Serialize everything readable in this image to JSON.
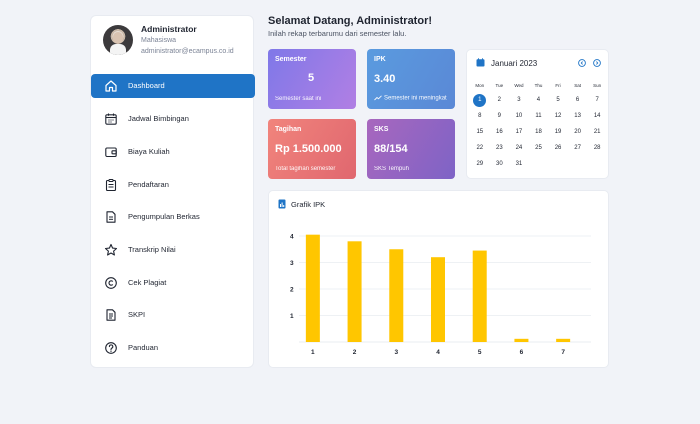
{
  "profile": {
    "name": "Administrator",
    "role": "Mahasiswa",
    "email": "administrator@ecampus.co.id"
  },
  "nav": [
    {
      "label": "Dashboard",
      "icon": "home-icon",
      "active": true
    },
    {
      "label": "Jadwal Bimbingan",
      "icon": "calendar-icon"
    },
    {
      "label": "Biaya Kuliah",
      "icon": "wallet-icon"
    },
    {
      "label": "Pendaftaran",
      "icon": "clipboard-icon"
    },
    {
      "label": "Pengumpulan Berkas",
      "icon": "file-icon"
    },
    {
      "label": "Transkrip Nilai",
      "icon": "star-icon"
    },
    {
      "label": "Cek Plagiat",
      "icon": "copyright-icon"
    },
    {
      "label": "SKPI",
      "icon": "document-icon"
    },
    {
      "label": "Panduan",
      "icon": "help-icon"
    }
  ],
  "header": {
    "title": "Selamat Datang, Administrator!",
    "subtitle": "Inilah rekap terbarumu dari semester lalu."
  },
  "stats": {
    "semester": {
      "label": "Semester",
      "value": "5",
      "caption": "Semester saat ini"
    },
    "ipk": {
      "label": "IPK",
      "value": "3.40",
      "caption": "Semester ini meningkat"
    },
    "tagihan": {
      "label": "Tagihan",
      "value": "Rp 1.500.000",
      "caption": "Total tagihan semester"
    },
    "sks": {
      "label": "SKS",
      "value": "88/154",
      "caption": "SKS Tempuh"
    }
  },
  "calendar": {
    "title": "Januari 2023",
    "weekdays": [
      "Mon",
      "Tue",
      "Wed",
      "Thu",
      "Fri",
      "Sat",
      "Sun"
    ],
    "weeks": [
      [
        "1",
        "2",
        "3",
        "4",
        "5",
        "6",
        "7"
      ],
      [
        "8",
        "9",
        "10",
        "11",
        "12",
        "13",
        "14"
      ],
      [
        "15",
        "16",
        "17",
        "18",
        "19",
        "20",
        "21"
      ],
      [
        "22",
        "23",
        "24",
        "25",
        "26",
        "27",
        "28"
      ],
      [
        "29",
        "30",
        "31",
        "",
        "",
        "",
        ""
      ]
    ],
    "today": "1",
    "accent": "#1f74c6"
  },
  "chart_data": {
    "type": "bar",
    "title": "Grafik IPK",
    "categories": [
      "1",
      "2",
      "3",
      "4",
      "5",
      "6",
      "7"
    ],
    "values": [
      4.05,
      3.8,
      3.5,
      3.2,
      3.45,
      0.12,
      0.12
    ],
    "ylim": [
      0,
      4
    ],
    "yticks": [
      "1",
      "2",
      "3",
      "4"
    ],
    "bar_color": "#ffc600",
    "grid": true
  },
  "colors": {
    "primary": "#1f74c6",
    "background": "#f1f3f8"
  }
}
